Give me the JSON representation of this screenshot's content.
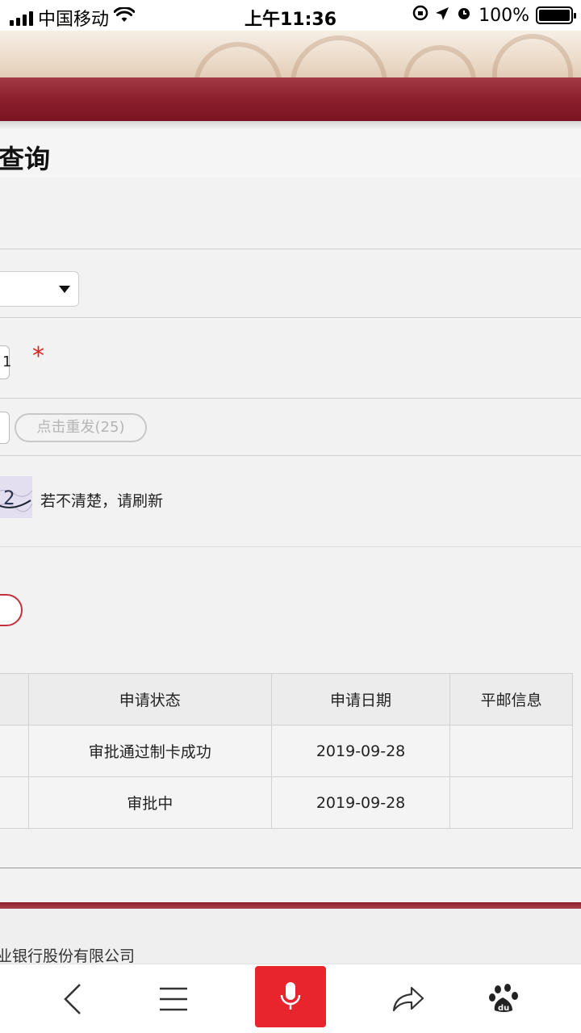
{
  "status_bar": {
    "carrier": "中国移动",
    "time": "上午11:36",
    "battery": "100%"
  },
  "page": {
    "title": "查询"
  },
  "form": {
    "id_value_partial": "1",
    "required_mark": "*",
    "resend_label": "点击重发(25)",
    "captcha_text": "2",
    "captcha_hint": "若不清楚，请刷新"
  },
  "table": {
    "headers": [
      "申请状态",
      "申请日期",
      "平邮信息"
    ],
    "rows": [
      {
        "status": "审批通过制卡成功",
        "date": "2019-09-28",
        "mail": ""
      },
      {
        "status": "审批中",
        "date": "2019-09-28",
        "mail": ""
      }
    ]
  },
  "footer": {
    "company_partial": "业银行股份有限公司"
  },
  "toolbar": {
    "items": [
      "back-icon",
      "menu-icon",
      "microphone-icon",
      "share-icon",
      "baidu-paw-icon"
    ]
  },
  "colors": {
    "brand_red": "#8a1e2b",
    "mic_red": "#e8242d",
    "required_red": "#e02020"
  }
}
